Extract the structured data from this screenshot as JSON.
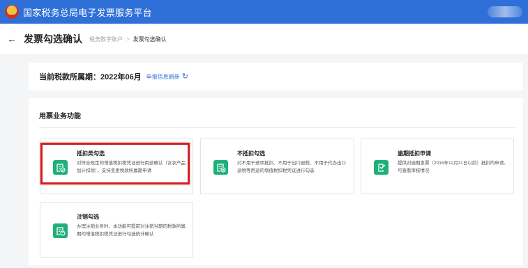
{
  "header": {
    "app_title": "国家税务总局电子发票服务平台"
  },
  "subbar": {
    "page_title": "发票勾选确认",
    "breadcrumb": [
      "税务数字账户",
      "发票勾选确认"
    ],
    "separator": ">"
  },
  "period": {
    "label": "当前税款所属期：",
    "value": "2022年06月",
    "refresh_label": "申报信息刷新"
  },
  "section": {
    "title": "用票业务功能"
  },
  "tiles": [
    {
      "title": "抵扣类勾选",
      "desc": "对符合规定的增值税扣税凭证进行用途确认（含农产品加计扣除），支持变更税款所属期申请",
      "icon": "invoice-check-icon",
      "highlighted": true
    },
    {
      "title": "不抵扣勾选",
      "desc": "对不用于进项抵扣、不用于出口退税、不用于代办出口退税等用途的增值税扣税凭证进行勾选",
      "icon": "invoice-cancel-icon"
    },
    {
      "title": "逾期抵扣申请",
      "desc": "提供对逾期发票（2016年12月31日以前）抵扣的申请、可查看审核情况",
      "icon": "document-edit-icon"
    },
    {
      "title": "注销勾选",
      "desc": "办理注销业务时，本功能可提前对注销当期的税款所属期的增值税扣税凭证进行勾选统计确认",
      "icon": "invoice-power-icon"
    }
  ],
  "colors": {
    "brand": "#2e6fd8",
    "icon_green": "#1fb07a",
    "highlight_red": "#d41e1e"
  }
}
